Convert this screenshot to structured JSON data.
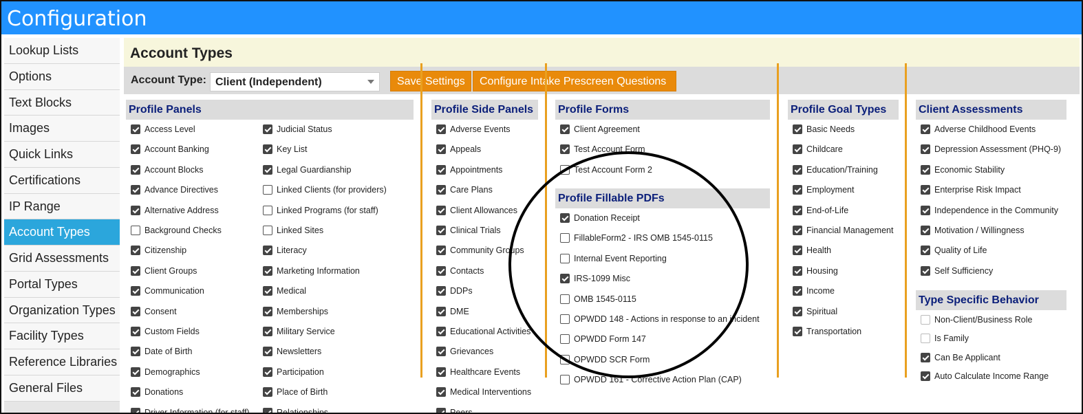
{
  "window": {
    "title": "Configuration"
  },
  "sidebar": {
    "items": [
      {
        "label": "Lookup Lists",
        "active": false
      },
      {
        "label": "Options",
        "active": false
      },
      {
        "label": "Text Blocks",
        "active": false
      },
      {
        "label": "Images",
        "active": false
      },
      {
        "label": "Quick Links",
        "active": false
      },
      {
        "label": "Certifications",
        "active": false
      },
      {
        "label": "IP Range",
        "active": false
      },
      {
        "label": "Account Types",
        "active": true
      },
      {
        "label": "Grid Assessments",
        "active": false
      },
      {
        "label": "Portal Types",
        "active": false
      },
      {
        "label": "Organization Types",
        "active": false
      },
      {
        "label": "Facility Types",
        "active": false
      },
      {
        "label": "Reference Libraries",
        "active": false
      },
      {
        "label": "General Files",
        "active": false
      }
    ]
  },
  "page": {
    "title": "Account Types"
  },
  "toolbar": {
    "account_type_label": "Account Type:",
    "account_type_value": "Client (Independent)",
    "save_label": "Save Settings",
    "configure_label": "Configure Intake Prescreen Questions"
  },
  "colors": {
    "accent": "#2192ff",
    "active_nav": "#2ba6dc",
    "button": "#e98a0b",
    "section_heading": "#0b1f7a",
    "divider": "#e9a020"
  },
  "profile_panels": {
    "heading": "Profile Panels",
    "col1": [
      {
        "label": "Access Level",
        "checked": true
      },
      {
        "label": "Account Banking",
        "checked": true
      },
      {
        "label": "Account Blocks",
        "checked": true
      },
      {
        "label": "Advance Directives",
        "checked": true
      },
      {
        "label": "Alternative Address",
        "checked": true
      },
      {
        "label": "Background Checks",
        "checked": false
      },
      {
        "label": "Citizenship",
        "checked": true
      },
      {
        "label": "Client Groups",
        "checked": true
      },
      {
        "label": "Communication",
        "checked": true
      },
      {
        "label": "Consent",
        "checked": true
      },
      {
        "label": "Custom Fields",
        "checked": true
      },
      {
        "label": "Date of Birth",
        "checked": true
      },
      {
        "label": "Demographics",
        "checked": true
      },
      {
        "label": "Donations",
        "checked": true
      },
      {
        "label": "Driver Information (for staff)",
        "checked": true
      }
    ],
    "col2": [
      {
        "label": "Judicial Status",
        "checked": true
      },
      {
        "label": "Key List",
        "checked": true
      },
      {
        "label": "Legal Guardianship",
        "checked": true
      },
      {
        "label": "Linked Clients (for providers)",
        "checked": false
      },
      {
        "label": "Linked Programs (for staff)",
        "checked": false
      },
      {
        "label": "Linked Sites",
        "checked": false
      },
      {
        "label": "Literacy",
        "checked": true
      },
      {
        "label": "Marketing Information",
        "checked": true
      },
      {
        "label": "Medical",
        "checked": true
      },
      {
        "label": "Memberships",
        "checked": true
      },
      {
        "label": "Military Service",
        "checked": true
      },
      {
        "label": "Newsletters",
        "checked": true
      },
      {
        "label": "Participation",
        "checked": true
      },
      {
        "label": "Place of Birth",
        "checked": true
      },
      {
        "label": "Relationships",
        "checked": true
      }
    ]
  },
  "profile_side_panels": {
    "heading": "Profile Side Panels",
    "items": [
      {
        "label": "Adverse Events",
        "checked": true
      },
      {
        "label": "Appeals",
        "checked": true
      },
      {
        "label": "Appointments",
        "checked": true
      },
      {
        "label": "Care Plans",
        "checked": true
      },
      {
        "label": "Client Allowances",
        "checked": true
      },
      {
        "label": "Clinical Trials",
        "checked": true
      },
      {
        "label": "Community Groups",
        "checked": true
      },
      {
        "label": "Contacts",
        "checked": true
      },
      {
        "label": "DDPs",
        "checked": true
      },
      {
        "label": "DME",
        "checked": true
      },
      {
        "label": "Educational Activities",
        "checked": true
      },
      {
        "label": "Grievances",
        "checked": true
      },
      {
        "label": "Healthcare Events",
        "checked": true
      },
      {
        "label": "Medical Interventions",
        "checked": true
      },
      {
        "label": "Peers",
        "checked": true
      }
    ]
  },
  "profile_forms": {
    "heading": "Profile Forms",
    "items": [
      {
        "label": "Client Agreement",
        "checked": true
      },
      {
        "label": "Test Account Form",
        "checked": true
      },
      {
        "label": "Test Account Form 2",
        "checked": false
      }
    ]
  },
  "profile_fillable_pdfs": {
    "heading": "Profile Fillable PDFs",
    "items": [
      {
        "label": "Donation Receipt",
        "checked": true
      },
      {
        "label": "FillableForm2 - IRS OMB 1545-0115",
        "checked": false
      },
      {
        "label": "Internal Event Reporting",
        "checked": false
      },
      {
        "label": "IRS-1099 Misc",
        "checked": true
      },
      {
        "label": "OMB 1545-0115",
        "checked": false
      },
      {
        "label": "OPWDD 148 - Actions in response to an incident",
        "checked": false
      },
      {
        "label": "OPWDD Form 147",
        "checked": false
      },
      {
        "label": "OPWDD SCR Form",
        "checked": false
      },
      {
        "label": "OPWDD 161 - Corrective Action Plan (CAP)",
        "checked": false
      }
    ]
  },
  "profile_goal_types": {
    "heading": "Profile Goal Types",
    "items": [
      {
        "label": "Basic Needs",
        "checked": true
      },
      {
        "label": "Childcare",
        "checked": true
      },
      {
        "label": "Education/Training",
        "checked": true
      },
      {
        "label": "Employment",
        "checked": true
      },
      {
        "label": "End-of-Life",
        "checked": true
      },
      {
        "label": "Financial Management",
        "checked": true
      },
      {
        "label": "Health",
        "checked": true
      },
      {
        "label": "Housing",
        "checked": true
      },
      {
        "label": "Income",
        "checked": true
      },
      {
        "label": "Spiritual",
        "checked": true
      },
      {
        "label": "Transportation",
        "checked": true
      }
    ]
  },
  "client_assessments": {
    "heading": "Client Assessments",
    "items": [
      {
        "label": "Adverse Childhood Events",
        "checked": true
      },
      {
        "label": "Depression Assessment (PHQ-9)",
        "checked": true
      },
      {
        "label": "Economic Stability",
        "checked": true
      },
      {
        "label": "Enterprise Risk Impact",
        "checked": true
      },
      {
        "label": "Independence in the Community",
        "checked": true
      },
      {
        "label": "Motivation / Willingness",
        "checked": true
      },
      {
        "label": "Quality of Life",
        "checked": true
      },
      {
        "label": "Self Sufficiency",
        "checked": true
      }
    ]
  },
  "type_specific_behavior": {
    "heading": "Type Specific Behavior",
    "items": [
      {
        "label": "Non-Client/Business Role",
        "checked": false,
        "disabled": true
      },
      {
        "label": "Is Family",
        "checked": false,
        "disabled": true
      },
      {
        "label": "Can Be Applicant",
        "checked": true,
        "disabled": false
      },
      {
        "label": "Auto Calculate Income Range",
        "checked": true,
        "disabled": false
      }
    ]
  }
}
